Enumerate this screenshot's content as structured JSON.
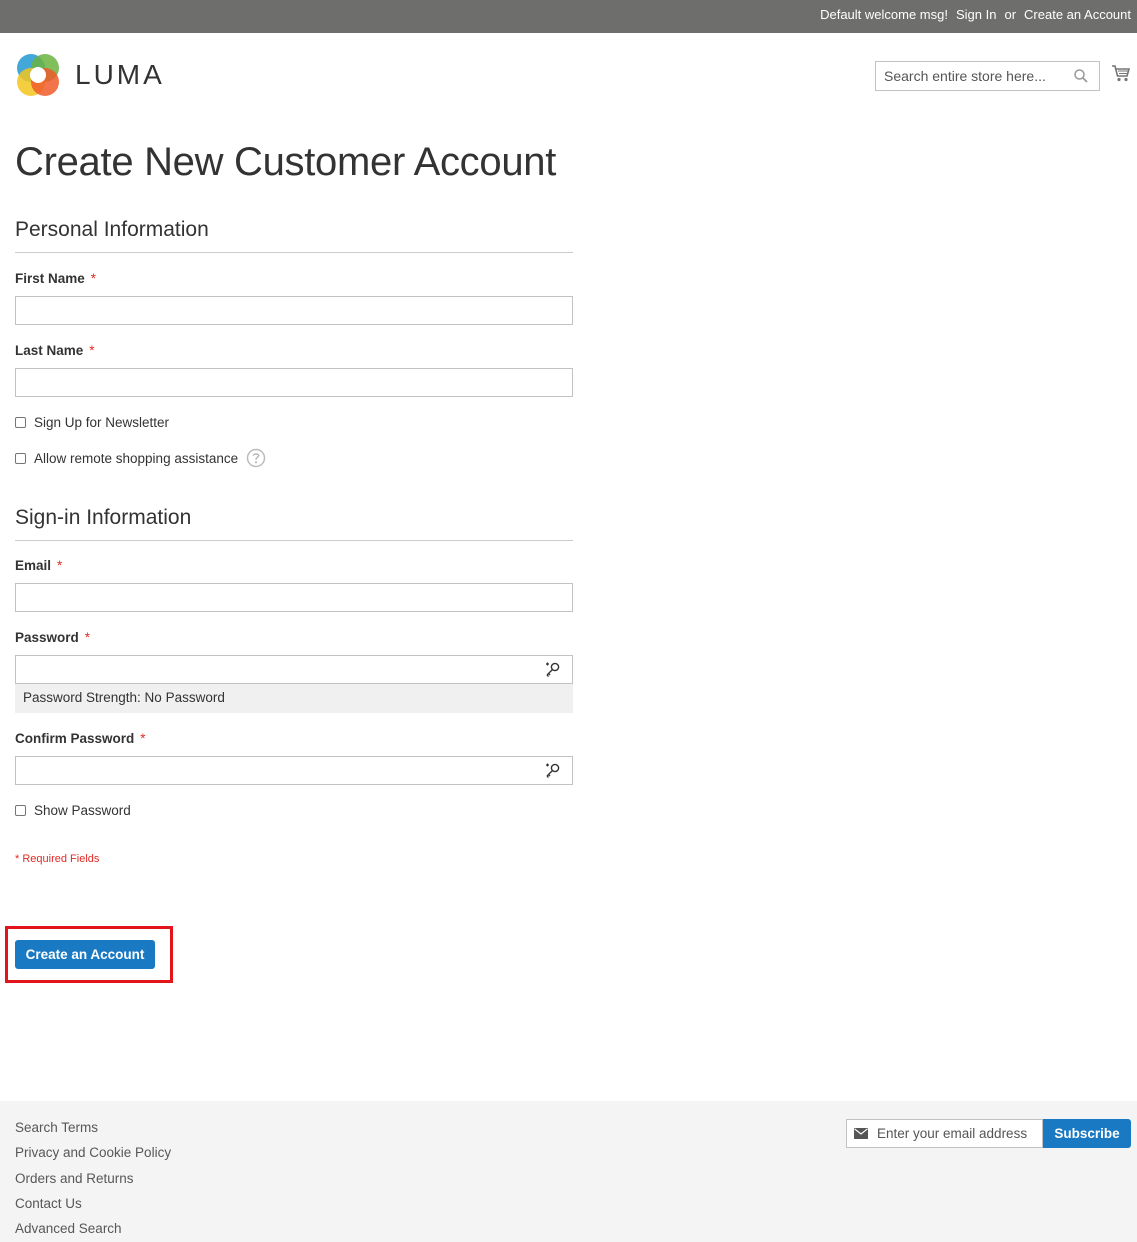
{
  "header": {
    "welcome": "Default welcome msg!",
    "sign_in": "Sign In",
    "or": "or",
    "create_account": "Create an Account",
    "logo_text": "LUMA",
    "search_placeholder": "Search entire store here..."
  },
  "page_title": "Create New Customer Account",
  "personal": {
    "title": "Personal Information",
    "first_name_label": "First Name",
    "last_name_label": "Last Name",
    "required_mark": "*",
    "newsletter_label": "Sign Up for Newsletter",
    "remote_label": "Allow remote shopping assistance"
  },
  "signin": {
    "title": "Sign-in Information",
    "email_label": "Email",
    "password_label": "Password",
    "strength_text": "Password Strength: No Password",
    "confirm_label": "Confirm Password",
    "show_password_label": "Show Password"
  },
  "required_fields_note": "* Required Fields",
  "submit_label": "Create an Account",
  "footer": {
    "links": [
      "Search Terms",
      "Privacy and Cookie Policy",
      "Orders and Returns",
      "Contact Us",
      "Advanced Search"
    ],
    "newsletter_placeholder": "Enter your email address",
    "subscribe_label": "Subscribe"
  },
  "colors": {
    "primary": "#1979c3",
    "topbar": "#6e6e6c",
    "required": "#e02b27",
    "highlight": "#e4141b"
  }
}
